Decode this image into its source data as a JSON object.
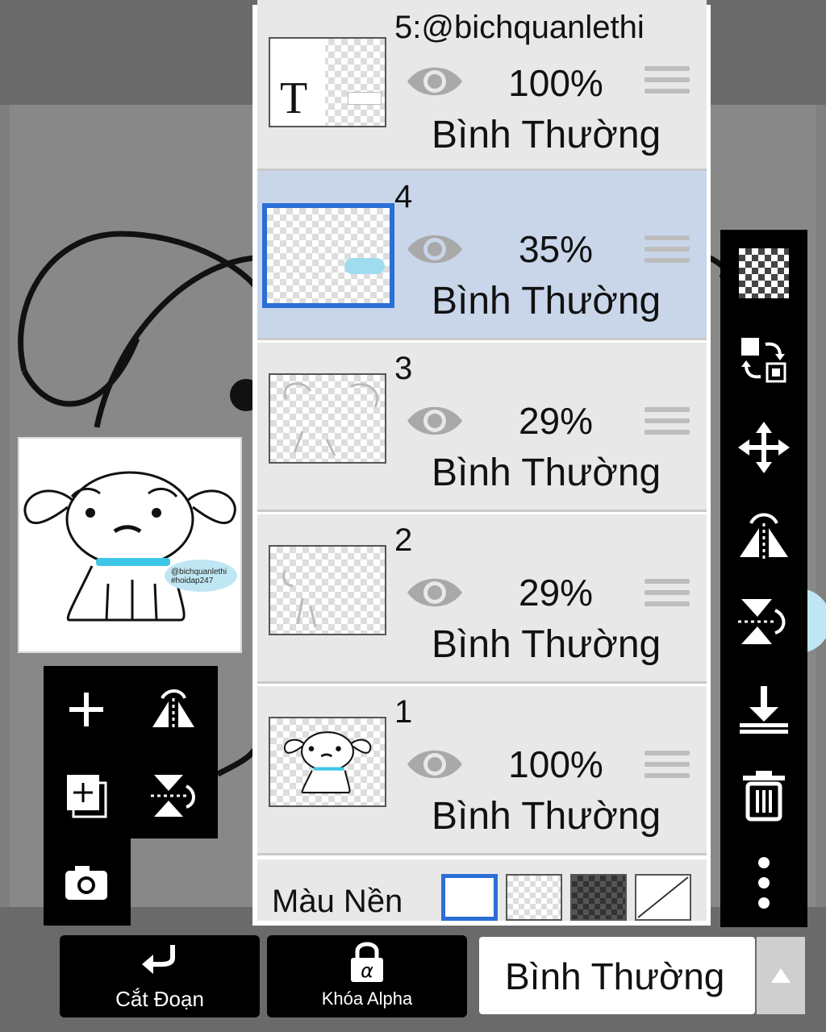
{
  "layers": [
    {
      "name": "5:@bichquanlethi",
      "opacity": "100%",
      "blend": "Bình Thường",
      "thumb_text": "T"
    },
    {
      "name": "4",
      "opacity": "35%",
      "blend": "Bình Thường"
    },
    {
      "name": "3",
      "opacity": "29%",
      "blend": "Bình Thường"
    },
    {
      "name": "2",
      "opacity": "29%",
      "blend": "Bình Thường"
    },
    {
      "name": "1",
      "opacity": "100%",
      "blend": "Bình Thường"
    }
  ],
  "selected_layer": "4",
  "background_color": {
    "label": "Màu Nền",
    "options": [
      "white",
      "transparent",
      "dark-checker",
      "none"
    ]
  },
  "preview": {
    "watermark_line1": "@bichquanlethi",
    "watermark_line2": "#hoidap247"
  },
  "bottom_bar": {
    "clip_label": "Cắt Đoạn",
    "alpha_lock_label": "Khóa Alpha",
    "blend_mode": "Bình Thường"
  },
  "colors": {
    "selection": "#2b6ed6",
    "selected_row": "#c9d6ea",
    "accent_cyan": "#3ec6e6"
  }
}
